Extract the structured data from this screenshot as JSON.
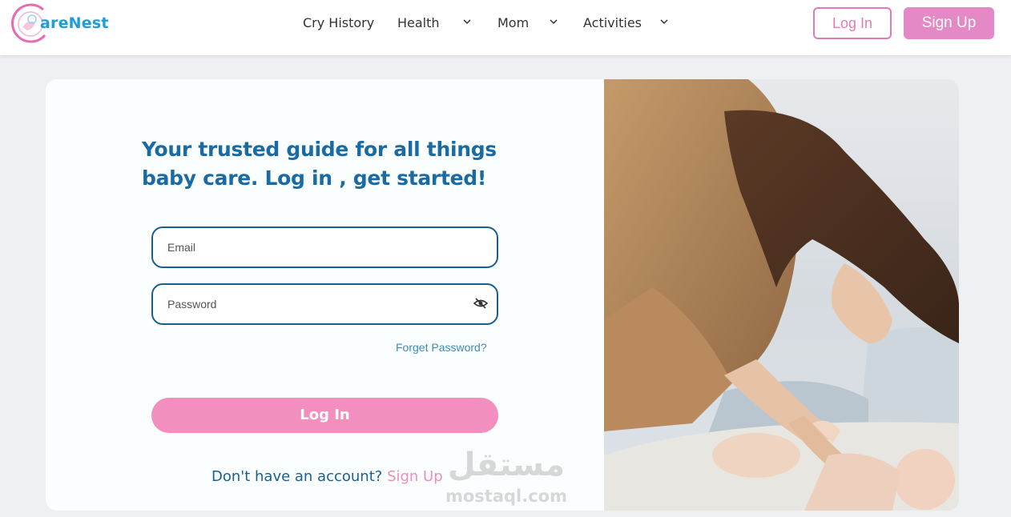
{
  "header": {
    "brand": "areNest",
    "nav": [
      {
        "label": "Cry History",
        "has_dropdown": false
      },
      {
        "label": "Health",
        "has_dropdown": true
      },
      {
        "label": "Mom",
        "has_dropdown": true
      },
      {
        "label": "Activities",
        "has_dropdown": true
      }
    ],
    "login_label": "Log In",
    "signup_label": "Sign Up"
  },
  "login": {
    "headline_line1": "Your trusted guide for all things",
    "headline_line2": "baby care. Log in , get started!",
    "email_placeholder": "Email",
    "email_value": "",
    "password_placeholder": "Password",
    "password_value": "",
    "forgot_label": "Forget Password?",
    "submit_label": "Log In",
    "no_account_text": "Don't have an account?",
    "signup_link": "Sign Up"
  },
  "watermark": {
    "arabic": "مستقل",
    "latin": "mostaql.com"
  },
  "colors": {
    "brand_blue": "#1a6aa3",
    "brand_pink": "#e589c6",
    "input_border": "#195f8e"
  }
}
